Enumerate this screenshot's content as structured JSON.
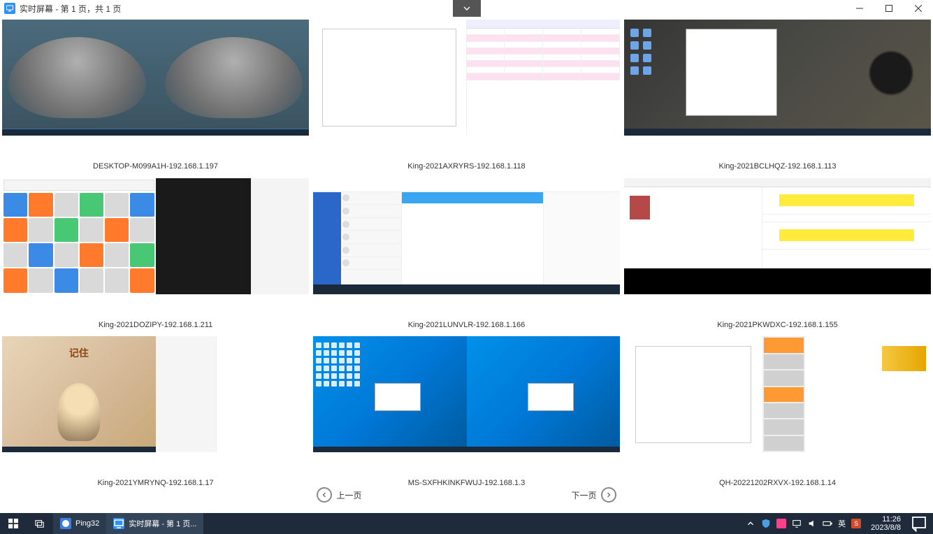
{
  "window": {
    "title": "实时屏幕 - 第 1 页，共 1 页"
  },
  "screens": [
    {
      "label": "DESKTOP-M099A1H-192.168.1.197"
    },
    {
      "label": "King-2021AXRYRS-192.168.1.118"
    },
    {
      "label": "King-2021BCLHQZ-192.168.1.113"
    },
    {
      "label": "King-2021DOZIPY-192.168.1.211"
    },
    {
      "label": "King-2021LUNVLR-192.168.1.166"
    },
    {
      "label": "King-2021PKWDXC-192.168.1.155"
    },
    {
      "label": "King-2021YMRYNQ-192.168.1.17"
    },
    {
      "label": "MS-SXFHKINKFWUJ-192.168.1.3"
    },
    {
      "label": "QH-20221202RXVX-192.168.1.14"
    }
  ],
  "pager": {
    "prev": "上一页",
    "next": "下一页"
  },
  "taskbar": {
    "app1": "Ping32",
    "app2": "实时屏幕 - 第 1 页...",
    "ime": "英",
    "time": "11:26",
    "date": "2023/8/8"
  },
  "thumb6": {
    "title": "记住"
  }
}
